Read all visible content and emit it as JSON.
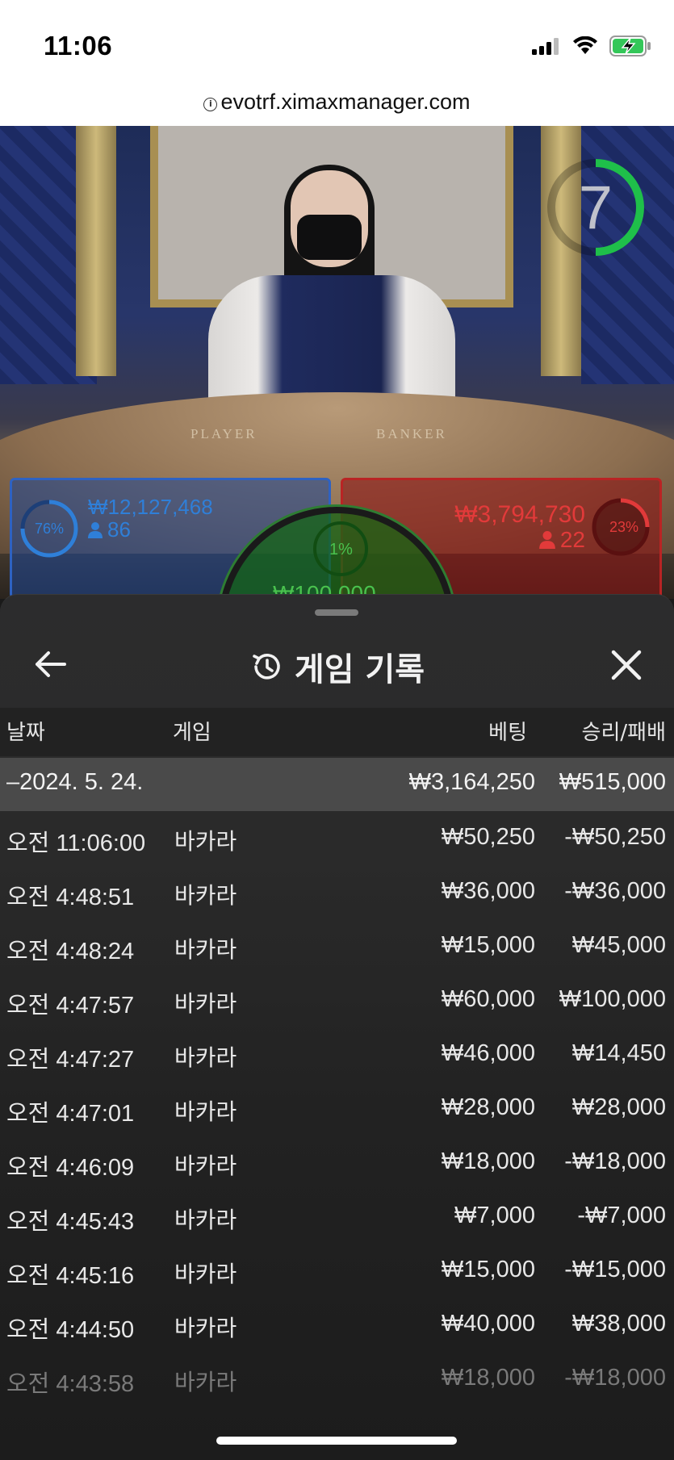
{
  "status_bar": {
    "time": "11:06",
    "icons": [
      "signal-icon",
      "wifi-icon",
      "battery-charging-icon"
    ]
  },
  "browser": {
    "url": "evotrf.ximaxmanager.com"
  },
  "stream": {
    "countdown": "7",
    "felt_player": "PLAYER",
    "felt_banker": "BANKER",
    "player": {
      "percent": "76%",
      "amount": "₩12,127,468",
      "count": "86"
    },
    "banker": {
      "percent": "23%",
      "amount": "₩3,794,730",
      "count": "22"
    },
    "tie": {
      "percent": "1%",
      "amount_partial": "₩100,000"
    }
  },
  "sheet": {
    "title": "게임 기록",
    "columns": {
      "date": "날짜",
      "game": "게임",
      "bet": "베팅",
      "result": "승리/패배"
    },
    "summary": {
      "date": "–2024. 5. 24.",
      "bet": "₩3,164,250",
      "result": "₩515,000"
    },
    "rows": [
      {
        "time": "오전 11:06:00",
        "game": "바카라",
        "bet": "₩50,250",
        "result": "-₩50,250"
      },
      {
        "time": "오전 4:48:51",
        "game": "바카라",
        "bet": "₩36,000",
        "result": "-₩36,000"
      },
      {
        "time": "오전 4:48:24",
        "game": "바카라",
        "bet": "₩15,000",
        "result": "₩45,000"
      },
      {
        "time": "오전 4:47:57",
        "game": "바카라",
        "bet": "₩60,000",
        "result": "₩100,000"
      },
      {
        "time": "오전 4:47:27",
        "game": "바카라",
        "bet": "₩46,000",
        "result": "₩14,450"
      },
      {
        "time": "오전 4:47:01",
        "game": "바카라",
        "bet": "₩28,000",
        "result": "₩28,000"
      },
      {
        "time": "오전 4:46:09",
        "game": "바카라",
        "bet": "₩18,000",
        "result": "-₩18,000"
      },
      {
        "time": "오전 4:45:43",
        "game": "바카라",
        "bet": "₩7,000",
        "result": "-₩7,000"
      },
      {
        "time": "오전 4:45:16",
        "game": "바카라",
        "bet": "₩15,000",
        "result": "-₩15,000"
      },
      {
        "time": "오전 4:44:50",
        "game": "바카라",
        "bet": "₩40,000",
        "result": "₩38,000"
      },
      {
        "time": "오전 4:43:58",
        "game": "바카라",
        "bet": "₩18,000",
        "result": "-₩18,000"
      }
    ]
  },
  "colors": {
    "player_blue": "#2f7fd8",
    "banker_red": "#e23a3a",
    "tie_green": "#49c24e",
    "timer_green": "#1fbf4a"
  }
}
